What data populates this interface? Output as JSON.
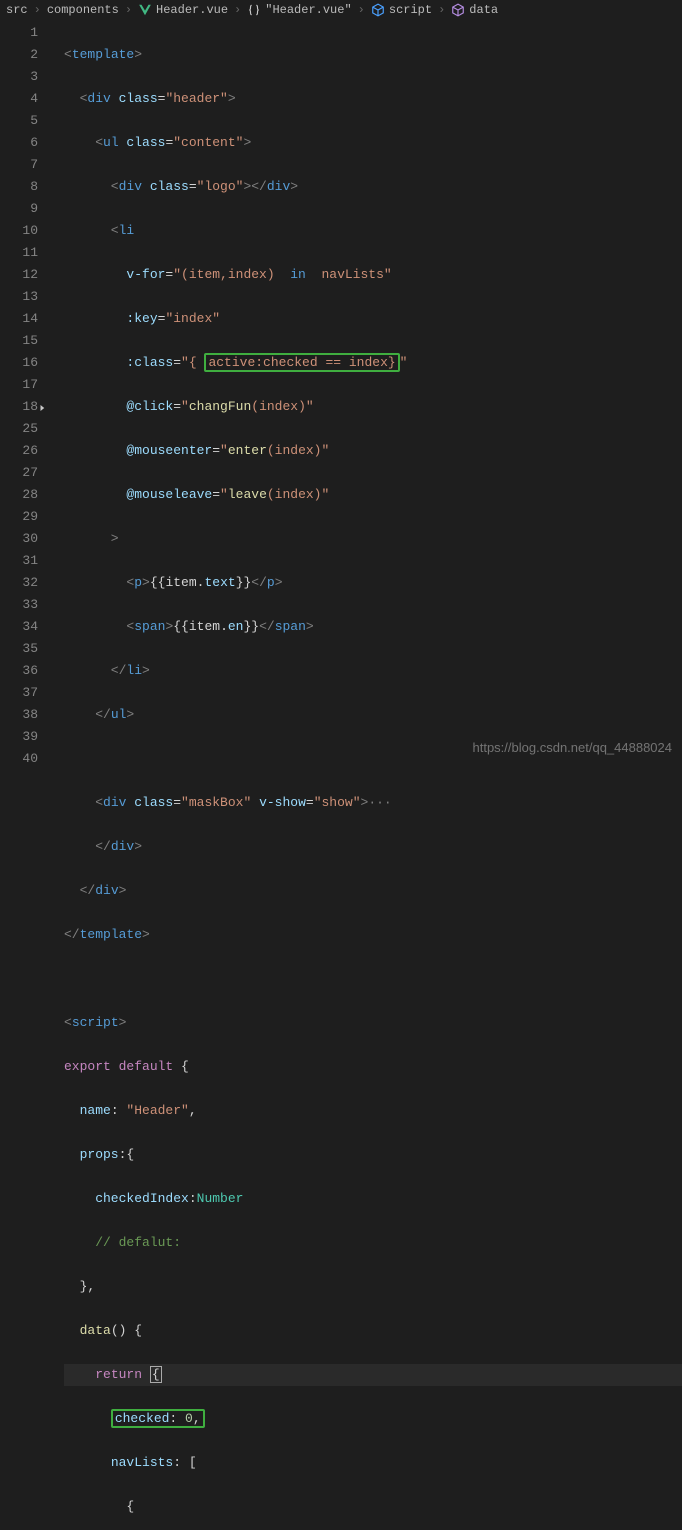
{
  "breadcrumb": {
    "src": "src",
    "components": "components",
    "file": "Header.vue",
    "block": "\"Header.vue\"",
    "script": "script",
    "data": "data"
  },
  "lines": {
    "l1": [
      "<",
      "template",
      ">"
    ],
    "l2": [
      "  <",
      "div",
      " class",
      "=",
      "\"header\"",
      ">"
    ],
    "l3": [
      "    <",
      "ul",
      " class",
      "=",
      "\"content\"",
      ">"
    ],
    "l4": [
      "      <",
      "div",
      " class",
      "=",
      "\"logo\"",
      "></",
      "div",
      ">"
    ],
    "l5": [
      "      <",
      "li"
    ],
    "l6": [
      "        v-for",
      "=",
      "\"(item,index) ",
      " in ",
      " navLists\""
    ],
    "l7": [
      "        :key",
      "=",
      "\"index\""
    ],
    "l8a": "        :class",
    "l8e": "=",
    "l8q1": "\"{ ",
    "l8box": "active:checked == index}",
    "l8q2": "\"",
    "l9": [
      "        @click",
      "=",
      "\"",
      "changFun",
      "(index)",
      "\""
    ],
    "l10": [
      "        @mouseenter",
      "=",
      "\"",
      "enter",
      "(index)",
      "\""
    ],
    "l11": [
      "        @mouseleave",
      "=",
      "\"",
      "leave",
      "(index)",
      "\""
    ],
    "l12": [
      "      >"
    ],
    "l13a": "        <",
    "l13tag": "p",
    "l13c": ">",
    "l13d": "{{",
    "l13e": "item.",
    "l13f": "text",
    "l13g": "}}",
    "l13h": "</",
    "l13i": "p",
    "l13j": ">",
    "l14a": "        <",
    "l14tag": "span",
    "l14c": ">",
    "l14d": "{{",
    "l14e": "item.",
    "l14f": "en",
    "l14g": "}}",
    "l14h": "</",
    "l14i": "span",
    "l14j": ">",
    "l15": [
      "      </",
      "li",
      ">"
    ],
    "l16": [
      "    </",
      "ul",
      ">"
    ],
    "l18a": "    <",
    "l18tag": "div",
    "l18c": " class",
    "l18d": "=",
    "l18e": "\"maskBox\"",
    "l18f": " v-show",
    "l18g": "=",
    "l18h": "\"show\"",
    "l18i": ">",
    "l18j": "···",
    "l25": [
      "    </",
      "div",
      ">"
    ],
    "l26": [
      "  </",
      "div",
      ">"
    ],
    "l27": [
      "</",
      "template",
      ">"
    ],
    "l29": [
      "<",
      "script",
      ">"
    ],
    "l30a": "export ",
    "l30b": "default ",
    "l30c": "{",
    "l31a": "  name",
    "l31b": ": ",
    "l31c": "\"Header\"",
    "l31d": ",",
    "l32a": "  props",
    "l32b": ":{",
    "l33a": "    checkedIndex",
    "l33b": ":",
    "l33c": "Number",
    "l34": "    // defalut:",
    "l35": "  },",
    "l36a": "  ",
    "l36b": "data",
    "l36c": "() {",
    "l37a": "    ",
    "l37b": "return ",
    "l37c": "{",
    "l38a": "      ",
    "l38b": "checked",
    "l38c": ": ",
    "l38d": "0",
    "l38e": ",",
    "l39a": "      ",
    "l39b": "navLists",
    "l39c": ": [",
    "l40": "        {"
  },
  "gutter": [
    "1",
    "2",
    "3",
    "4",
    "5",
    "6",
    "7",
    "8",
    "9",
    "10",
    "11",
    "12",
    "13",
    "14",
    "15",
    "16",
    "17",
    "18",
    "25",
    "26",
    "27",
    "28",
    "29",
    "30",
    "31",
    "32",
    "33",
    "34",
    "35",
    "36",
    "37",
    "38",
    "39",
    "40"
  ],
  "watermark": "https://blog.csdn.net/qq_44888024"
}
